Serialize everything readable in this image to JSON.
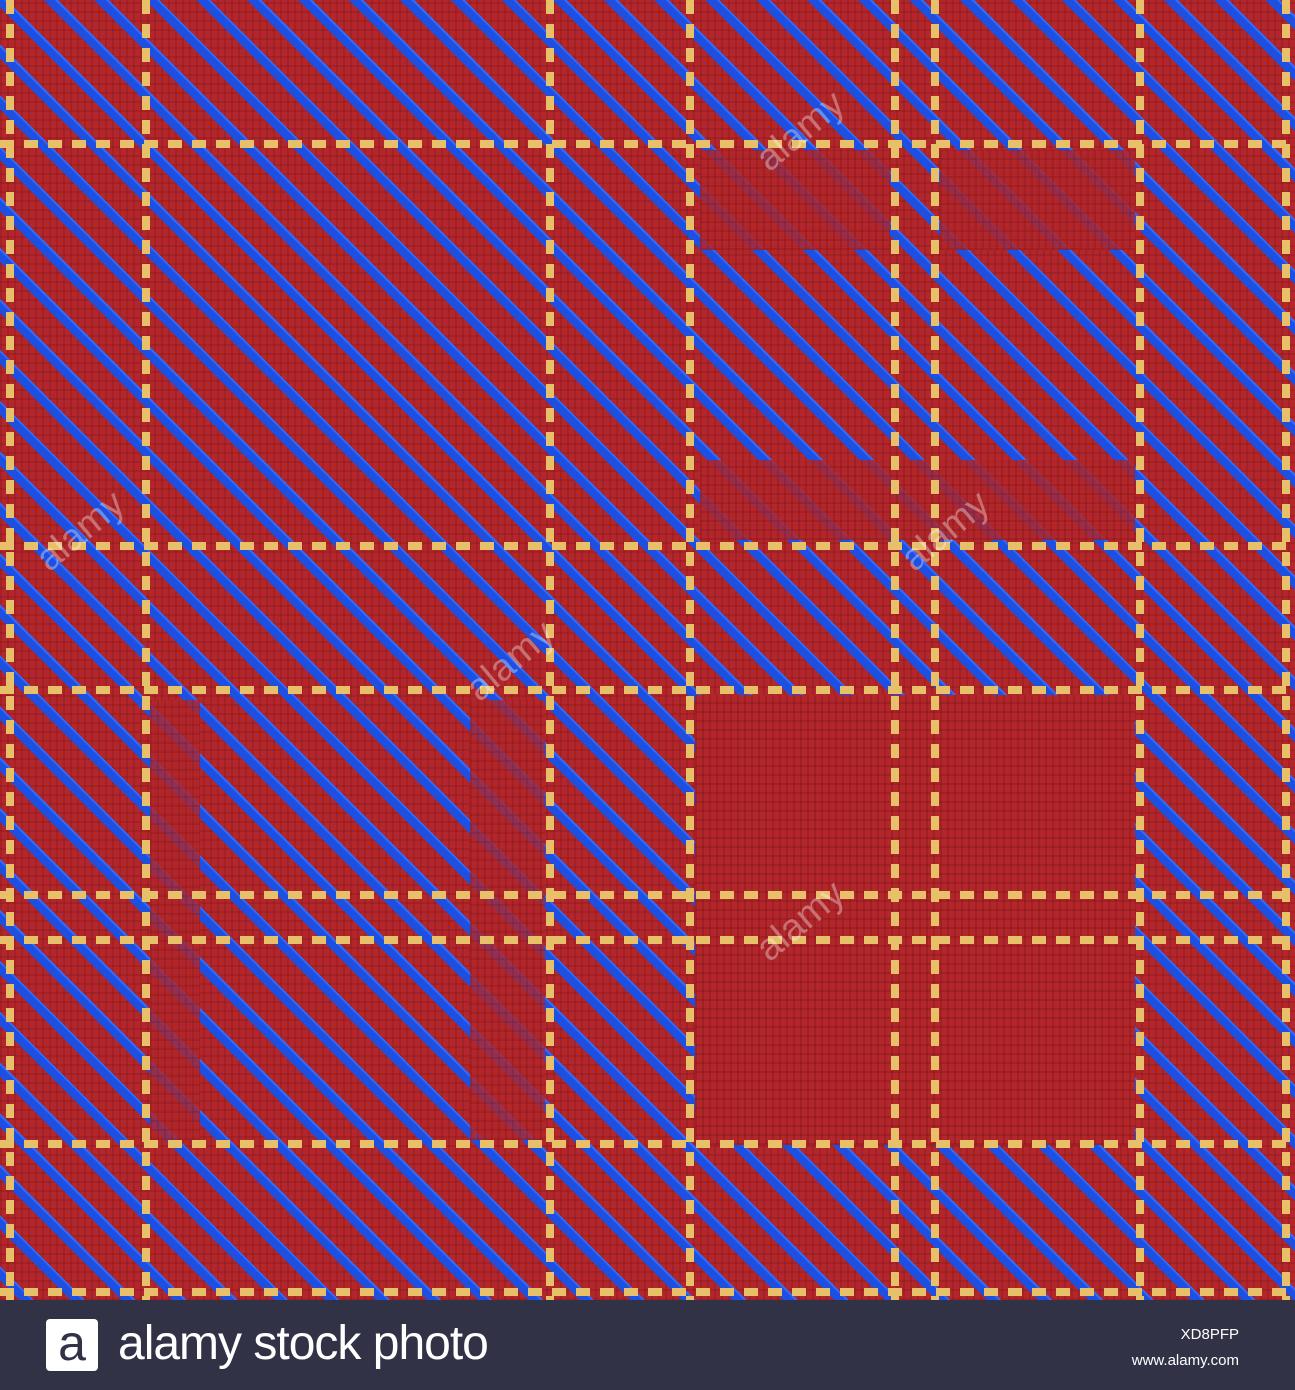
{
  "image": {
    "subject": "tartan-plaid-pattern",
    "colors": {
      "red": "#b3262b",
      "blue": "#1d4fe0",
      "gold": "#e8c06a",
      "banner": "#323247"
    }
  },
  "watermark": {
    "text": "alamy",
    "letter": "a"
  },
  "banner": {
    "logo_letter": "a",
    "brand": "alamy stock photo",
    "image_id": "XD8PFP",
    "website": "www.alamy.com"
  }
}
